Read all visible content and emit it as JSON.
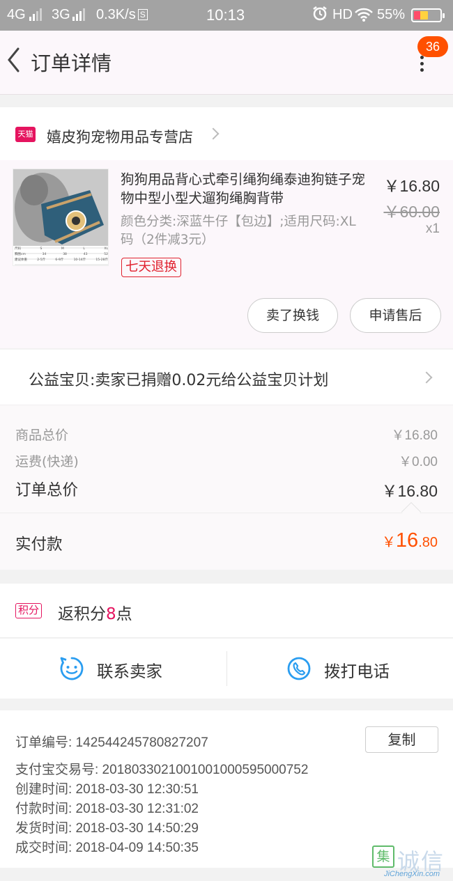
{
  "status_bar": {
    "network1": "4G",
    "network2": "3G",
    "speed": "0.3K/s",
    "speed_icon": "S",
    "time": "10:13",
    "hd": "HD",
    "battery": "55%",
    "battery_level": 0.55
  },
  "nav": {
    "title": "订单详情",
    "badge": "36",
    "back_icon": "chevron-left-icon",
    "more_icon": "more-vertical-icon"
  },
  "shop": {
    "icon_label": "天猫",
    "name": "嬉皮狗宠物用品专营店"
  },
  "item": {
    "title": "狗狗用品背心式牵引绳狗绳泰迪狗链子宠物中型小型犬遛狗绳胸背带",
    "spec": "颜色分类:深蓝牛仔【包边】;适用尺码:XL码（2件减3元）",
    "tag": "七天退换",
    "price": "￥16.80",
    "original_price": "￥60.00",
    "quantity": "x1",
    "thumb_table": {
      "header": [
        "尺码",
        "S",
        "M",
        "L",
        "XL"
      ],
      "row1": [
        "胸围cm",
        "34",
        "38",
        "43",
        "52"
      ],
      "row2": [
        "建议体重",
        "2-5斤",
        "6-9斤",
        "10-14斤",
        "15-28斤"
      ]
    },
    "actions": {
      "sell": "卖了换钱",
      "aftersale": "申请售后"
    }
  },
  "charity": {
    "text": "公益宝贝:卖家已捐赠0.02元给公益宝贝计划"
  },
  "summary": {
    "goods_label": "商品总价",
    "goods_value": "￥16.80",
    "shipping_label": "运费(快递)",
    "shipping_value": "￥0.00",
    "total_label": "订单总价",
    "total_value": "￥16.80",
    "paid_label": "实付款",
    "paid_currency": "￥",
    "paid_int": "16",
    "paid_dec": ".80"
  },
  "points": {
    "tag": "积分",
    "prefix": "返积分",
    "value": "8",
    "suffix": "点"
  },
  "contact": {
    "seller": "联系卖家",
    "phone": "拨打电话"
  },
  "info": {
    "order_no": "订单编号:   142544245780827207",
    "copy": "复制",
    "alipay_no": "支付宝交易号:   2018033021001001000595000752",
    "created": "创建时间:   2018-03-30 12:30:51",
    "paid": "付款时间:   2018-03-30 12:31:02",
    "shipped": "发货时间:   2018-03-30 14:50:29",
    "completed": "成交时间:   2018-04-09 14:50:35"
  },
  "watermark": {
    "logo": "集",
    "text": "诚信",
    "url": "JiChengXin.com"
  },
  "colors": {
    "accent": "#ff5000",
    "tmall": "#e5145f",
    "return_tag": "#e0212e",
    "icon_blue": "#2a9df0"
  }
}
